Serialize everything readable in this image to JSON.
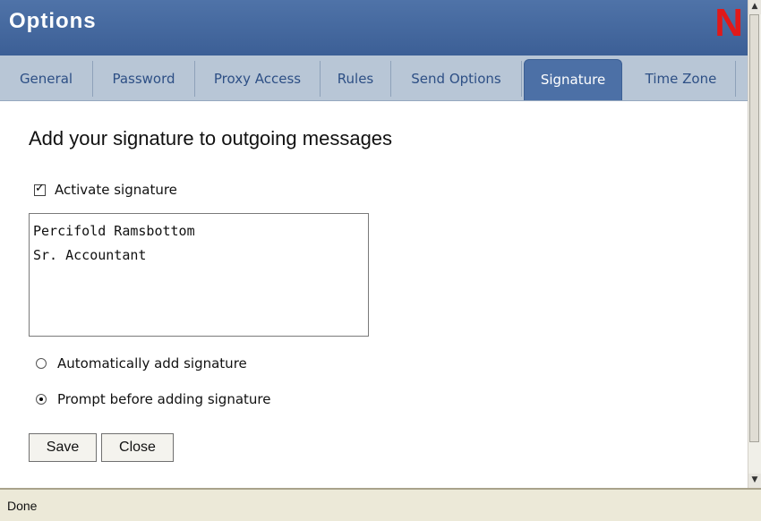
{
  "window": {
    "title": "Options",
    "logo_text": "N"
  },
  "tabs": [
    {
      "label": "General"
    },
    {
      "label": "Password"
    },
    {
      "label": "Proxy Access"
    },
    {
      "label": "Rules"
    },
    {
      "label": "Send Options"
    },
    {
      "label": "Signature",
      "active": true
    },
    {
      "label": "Time Zone"
    }
  ],
  "content": {
    "heading": "Add your signature to outgoing messages",
    "activate_label": "Activate signature",
    "activate_checked": true,
    "signature_lines": [
      "Percifold Ramsbottom",
      "Sr. Accountant"
    ],
    "radio_auto_label": "Automatically add signature",
    "radio_prompt_label": "Prompt before adding signature",
    "selected_radio": "prompt"
  },
  "buttons": {
    "save": "Save",
    "close": "Close"
  },
  "status": {
    "text": "Done"
  },
  "colors": {
    "title_bg": "#4a6fa5",
    "tab_bg": "#b8c6d6",
    "active_tab": "#4c70a6",
    "logo": "#e11919"
  }
}
